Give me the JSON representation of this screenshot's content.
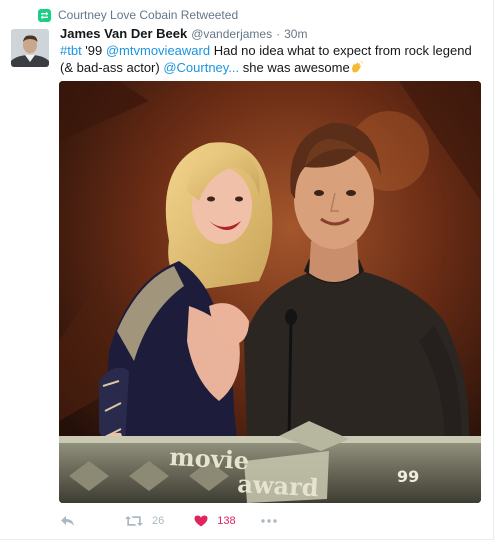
{
  "context": {
    "retweeted_by": "Courtney Love Cobain Retweeted"
  },
  "tweet": {
    "author_name": "James Van Der Beek",
    "author_handle": "@vanderjames",
    "separator": "·",
    "time": "30m",
    "text": {
      "hashtag": "#tbt",
      "part1": " '99 ",
      "mention1": "@mtvmovieaward",
      "part2": " Had no idea what to expect from rock legend (& bad-ass actor) ",
      "mention2": "@Courtney...",
      "part3": " she was awesome"
    },
    "emoji": "clapping-hands"
  },
  "photo": {
    "podium_text_1": "movie",
    "podium_text_2": "award",
    "podium_year": "99"
  },
  "actions": {
    "retweet_count": "26",
    "like_count": "138"
  },
  "colors": {
    "link": "#1b95e0",
    "retweet_green": "#19cf86",
    "like_red": "#e0245e",
    "muted": "#657786",
    "action_grey": "#aab8c2"
  }
}
